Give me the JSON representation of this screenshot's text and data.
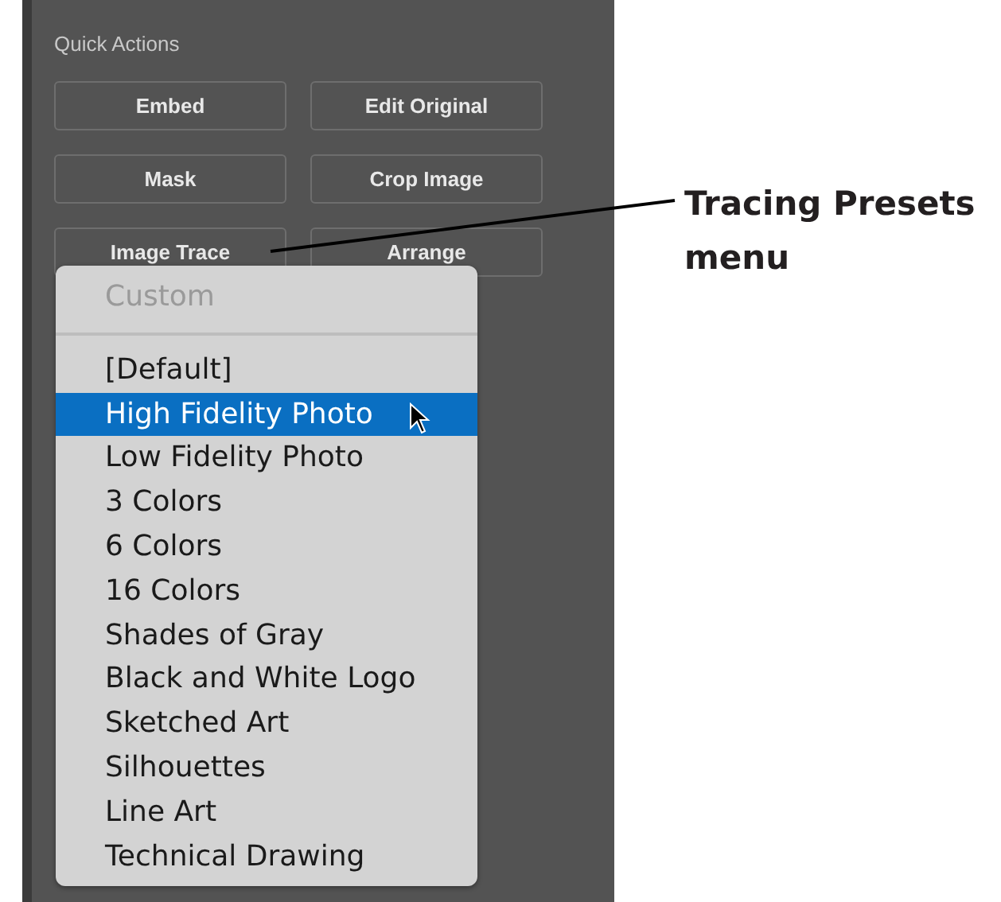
{
  "panel": {
    "title": "Quick Actions",
    "buttons": [
      {
        "label": "Embed"
      },
      {
        "label": "Edit Original"
      },
      {
        "label": "Mask"
      },
      {
        "label": "Crop Image"
      },
      {
        "label": "Image Trace"
      },
      {
        "label": "Arrange"
      }
    ]
  },
  "menu": {
    "items": [
      {
        "label": "Custom",
        "disabled": true,
        "selected": false,
        "separator_after": true
      },
      {
        "label": "[Default]",
        "disabled": false,
        "selected": false
      },
      {
        "label": "High Fidelity Photo",
        "disabled": false,
        "selected": true
      },
      {
        "label": "Low Fidelity Photo",
        "disabled": false,
        "selected": false
      },
      {
        "label": "3 Colors",
        "disabled": false,
        "selected": false
      },
      {
        "label": "6 Colors",
        "disabled": false,
        "selected": false
      },
      {
        "label": "16 Colors",
        "disabled": false,
        "selected": false
      },
      {
        "label": "Shades of Gray",
        "disabled": false,
        "selected": false
      },
      {
        "label": "Black and White Logo",
        "disabled": false,
        "selected": false
      },
      {
        "label": "Sketched Art",
        "disabled": false,
        "selected": false
      },
      {
        "label": "Silhouettes",
        "disabled": false,
        "selected": false
      },
      {
        "label": "Line Art",
        "disabled": false,
        "selected": false
      },
      {
        "label": "Technical Drawing",
        "disabled": false,
        "selected": false
      }
    ]
  },
  "callout": {
    "text": "Tracing Presets menu"
  }
}
